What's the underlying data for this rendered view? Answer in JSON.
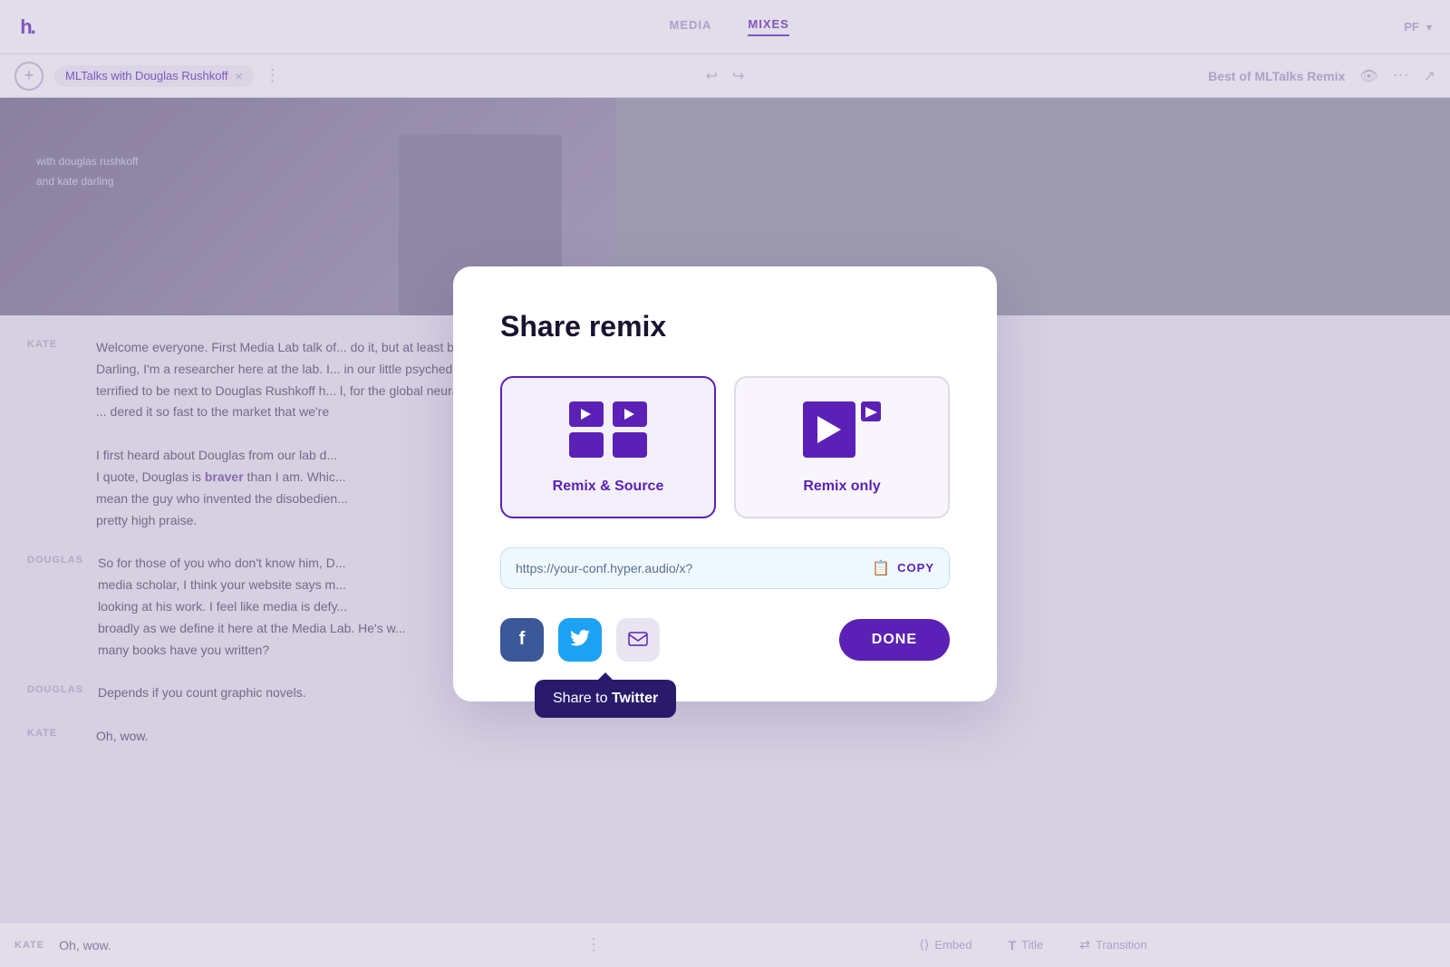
{
  "nav": {
    "logo": "h.",
    "tabs": [
      {
        "id": "media",
        "label": "MEDIA",
        "active": false
      },
      {
        "id": "mixes",
        "label": "MIXES",
        "active": true
      }
    ],
    "user": "PF",
    "dropdown_icon": "▾"
  },
  "secondary_bar": {
    "tab_label": "MLTalks with Douglas Rushkoff",
    "close_icon": "×",
    "more_icon": "⋮",
    "undo_icon": "↩",
    "redo_icon": "↪",
    "remix_title": "Best of MLTalks Remix",
    "view_icon": "👁",
    "more_dots": "⋯",
    "export_icon": "⬡"
  },
  "transcript": {
    "speaker1": "KATE",
    "text1_p1": "Welcome everyone. First Media Lab talk of... do it, but at least be training wheels",
    "text1_p2": "Darling, I'm a researcher here at the lab. I... in our little psychedelic world we",
    "text1_p3": "terrified to be next to Douglas Rushkoff h... l, for the global neural pathways to",
    "text1_p4": "... dered it so fast to the market that we're",
    "text2_p1": "I first heard about Douglas from our lab d...",
    "highlight_word": "braver",
    "text2_rest": "than I am. Whic...",
    "text2_p2": "mean the guy who invented the disobedien...",
    "text2_p3": "pretty high praise."
  },
  "speaker2": {
    "name": "DOUGLAS",
    "text": "So for those of you who don't know him, D... media scholar, I think your website says m... looking at his work. I feel like media is defy... broadly as we define it here at the Media Lab. He's w... many books have you written?"
  },
  "speaker3_bottom": {
    "name": "DOUGLAS",
    "text": "Depends if you count graphic novels."
  },
  "speaker4_bottom": {
    "name": "KATE",
    "text": "Oh, wow."
  },
  "bottom_bar": {
    "embed_icon": "⟨⟩",
    "embed_label": "Embed",
    "title_icon": "T",
    "title_label": "Title",
    "transition_icon": "⇄",
    "transition_label": "Transition"
  },
  "modal": {
    "title": "Share remix",
    "card1": {
      "label": "Remix & Source",
      "selected": true
    },
    "card2": {
      "label": "Remix only",
      "selected": false
    },
    "url": "https://your-conf.hyper.audio/x?",
    "copy_label": "COPY",
    "social": {
      "facebook_label": "f",
      "twitter_label": "🐦",
      "email_label": "✉"
    },
    "twitter_tooltip": {
      "prefix": "Share to ",
      "bold": "Twitter"
    },
    "done_label": "DONE"
  }
}
